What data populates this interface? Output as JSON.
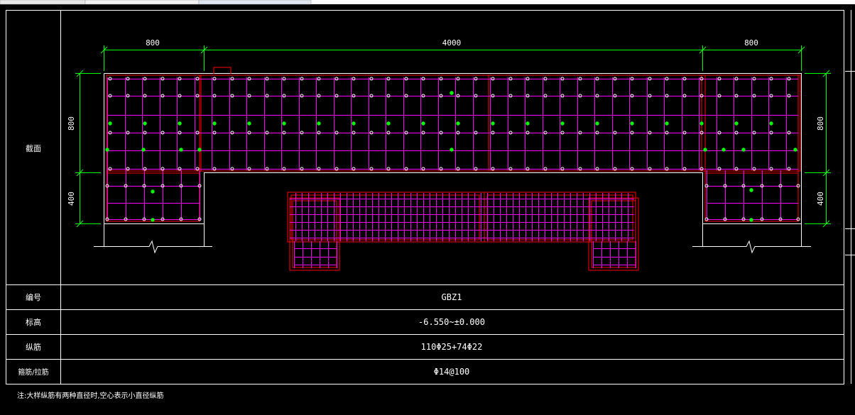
{
  "table": {
    "rows": [
      {
        "label": "截面",
        "value": ""
      },
      {
        "label": "编号",
        "value": "GBZ1"
      },
      {
        "label": "标高",
        "value": "-6.550~±0.000"
      },
      {
        "label": "纵筋",
        "value": "110Φ25+74Φ22"
      },
      {
        "label": "箍筋/拉筋",
        "value": "Φ14@100"
      }
    ]
  },
  "dimensions": {
    "top": [
      "800",
      "4000",
      "800"
    ],
    "left": [
      "800",
      "400"
    ],
    "right": [
      "800",
      "400"
    ]
  },
  "note": "注:大样纵筋有两种直径时,空心表示小直径纵筋",
  "colors": {
    "background": "#000000",
    "frame": "#ffffff",
    "dimension": "#00ff00",
    "rebar_tie": "#ff00ff",
    "outline_red": "#ff0000",
    "bar_small": "#ffffff",
    "bar_large": "#00ff00"
  }
}
